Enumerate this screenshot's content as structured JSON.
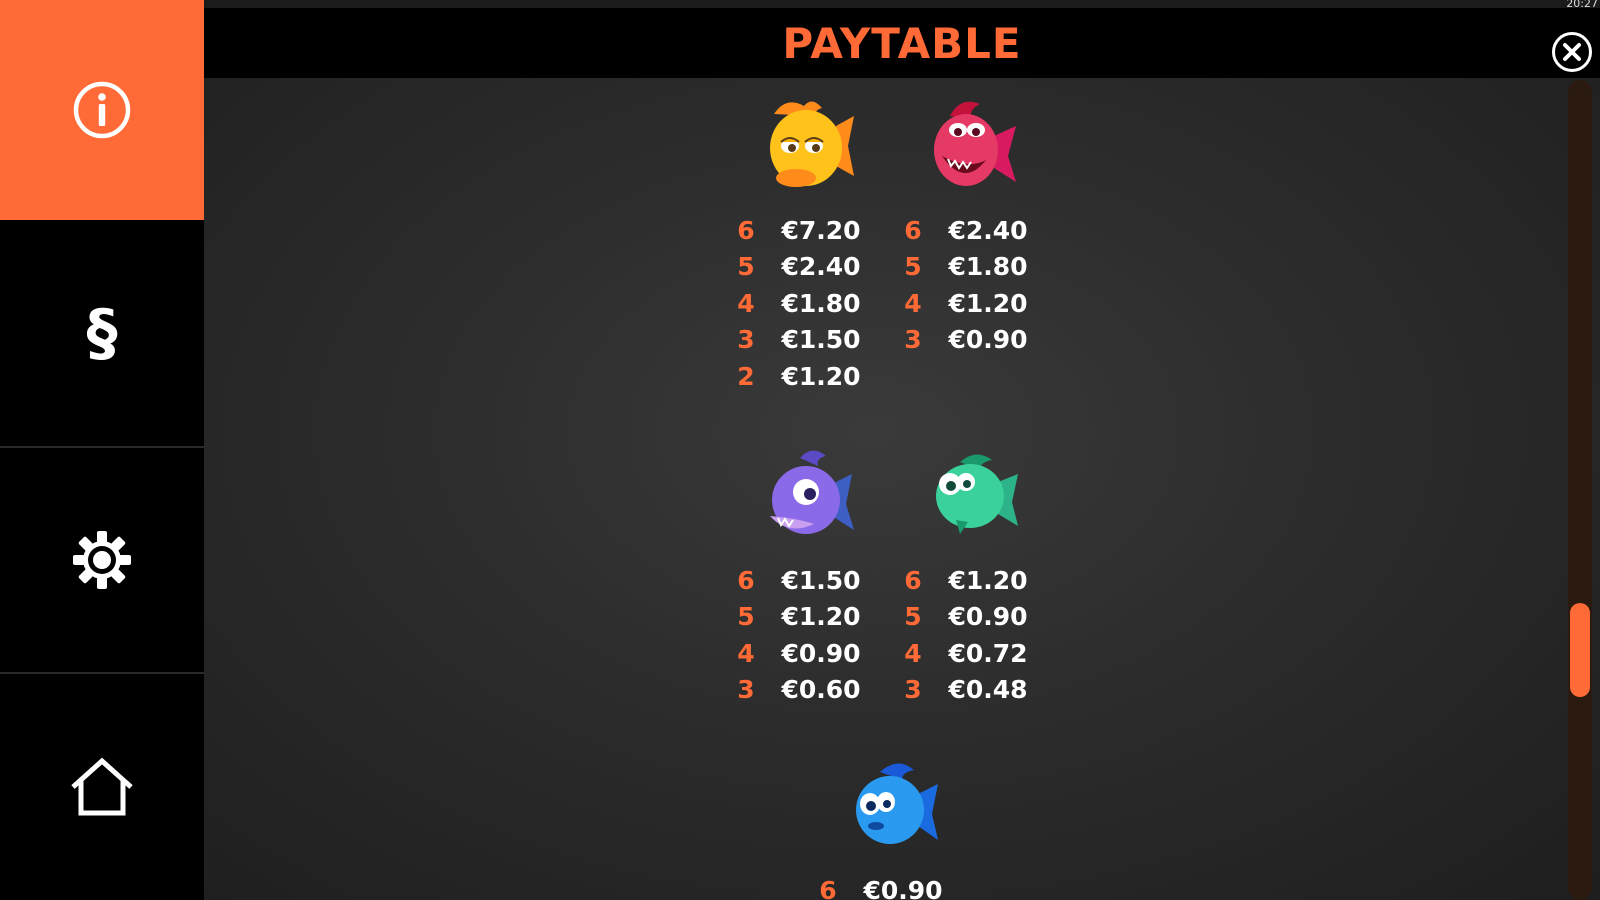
{
  "header": {
    "title": "PAYTABLE",
    "clock": "20:27"
  },
  "icons": {
    "info": "info-icon",
    "rules": "section-sign-icon",
    "settings": "gear-icon",
    "home": "home-icon",
    "close": "close-icon"
  },
  "sidebar": {
    "rules_glyph": "§"
  },
  "colors": {
    "accent": "#ff6a36",
    "background": "#2a2a2a",
    "panel": "#000000"
  },
  "symbols": [
    {
      "name": "yellow-fish",
      "pays": [
        {
          "count": "6",
          "amount": "€7.20"
        },
        {
          "count": "5",
          "amount": "€2.40"
        },
        {
          "count": "4",
          "amount": "€1.80"
        },
        {
          "count": "3",
          "amount": "€1.50"
        },
        {
          "count": "2",
          "amount": "€1.20"
        }
      ]
    },
    {
      "name": "red-fish",
      "pays": [
        {
          "count": "6",
          "amount": "€2.40"
        },
        {
          "count": "5",
          "amount": "€1.80"
        },
        {
          "count": "4",
          "amount": "€1.20"
        },
        {
          "count": "3",
          "amount": "€0.90"
        }
      ]
    },
    {
      "name": "purple-fish",
      "pays": [
        {
          "count": "6",
          "amount": "€1.50"
        },
        {
          "count": "5",
          "amount": "€1.20"
        },
        {
          "count": "4",
          "amount": "€0.90"
        },
        {
          "count": "3",
          "amount": "€0.60"
        }
      ]
    },
    {
      "name": "green-fish",
      "pays": [
        {
          "count": "6",
          "amount": "€1.20"
        },
        {
          "count": "5",
          "amount": "€0.90"
        },
        {
          "count": "4",
          "amount": "€0.72"
        },
        {
          "count": "3",
          "amount": "€0.48"
        }
      ]
    },
    {
      "name": "blue-fish",
      "pays": [
        {
          "count": "6",
          "amount": "€0.90"
        }
      ]
    }
  ],
  "scroll": {
    "position": 0.72
  }
}
